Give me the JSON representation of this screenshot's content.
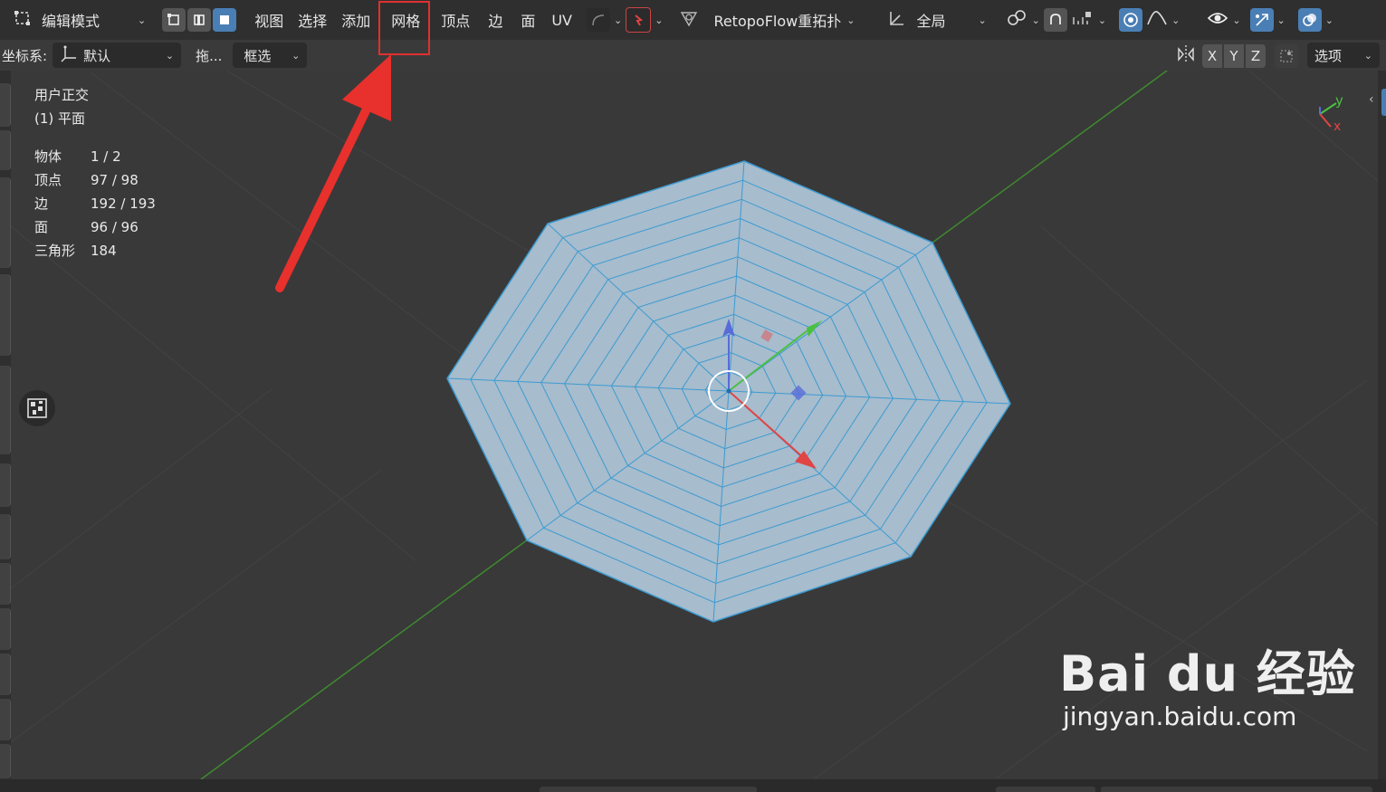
{
  "header": {
    "mode": "编辑模式",
    "menus": [
      "视图",
      "选择",
      "添加",
      "网格",
      "顶点",
      "边",
      "面",
      "UV"
    ],
    "retopo": "RetopoFlow重拓扑",
    "transform_orientation": "全局"
  },
  "toolbar": {
    "coord_label": "坐标系:",
    "coord_value": "默认",
    "drag_label": "拖...",
    "select_mode": "框选",
    "axis_x": "X",
    "axis_y": "Y",
    "axis_z": "Z",
    "options": "选项"
  },
  "viewport": {
    "view_name": "用户正交",
    "object_name": "(1) 平面",
    "stats": [
      {
        "label": "物体",
        "value": "1 / 2"
      },
      {
        "label": "顶点",
        "value": "97 / 98"
      },
      {
        "label": "边",
        "value": "192 / 193"
      },
      {
        "label": "面",
        "value": "96 / 96"
      },
      {
        "label": "三角形",
        "value": "184"
      }
    ],
    "gizmo_y": "y",
    "gizmo_x": "x"
  },
  "watermark": {
    "brand": "Bai du 经验",
    "url": "jingyan.baidu.com"
  },
  "colors": {
    "mesh_fill": "#a7bccd",
    "mesh_edge": "#3c9bd1",
    "axis_green": "#3f8a2f",
    "highlight_red": "#e03030",
    "accent_blue": "#4a7fb5"
  }
}
